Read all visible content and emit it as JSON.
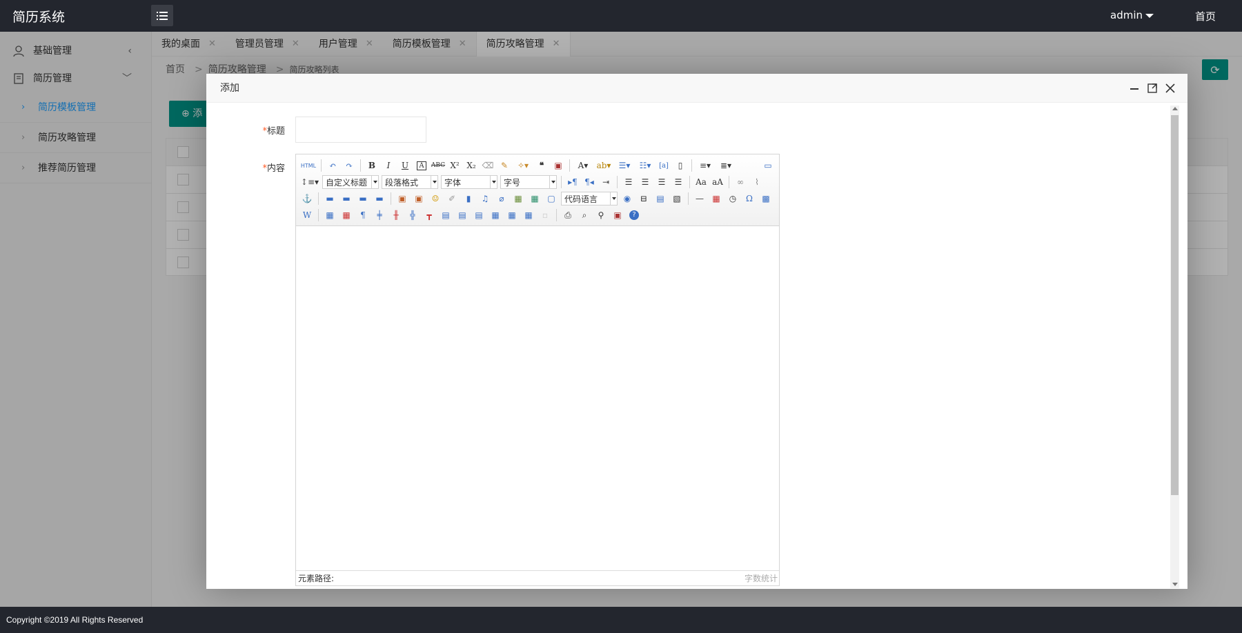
{
  "header": {
    "logo": "简历系统",
    "user": "admin",
    "home": "首页"
  },
  "sidebar": {
    "groups": [
      {
        "label": "基础管理",
        "icon": "user-icon",
        "chevron": "‹"
      },
      {
        "label": "简历管理",
        "icon": "document-icon",
        "chevron": "﹀"
      }
    ],
    "items": [
      {
        "label": "简历模板管理"
      },
      {
        "label": "简历攻略管理"
      },
      {
        "label": "推荐简历管理"
      }
    ]
  },
  "tabs": [
    {
      "label": "我的桌面"
    },
    {
      "label": "管理员管理"
    },
    {
      "label": "用户管理"
    },
    {
      "label": "简历模板管理"
    },
    {
      "label": "简历攻略管理"
    }
  ],
  "breadcrumb": {
    "home": "首页",
    "section": "简历攻略管理",
    "page": "简历攻略列表",
    "sep": ">"
  },
  "content": {
    "add_label": "添加"
  },
  "modal": {
    "title": "添加",
    "form": {
      "title_label": "标题",
      "content_label": "内容",
      "required_mark": "*"
    },
    "editor": {
      "html_label": "HTML",
      "custom_title": "自定义标题",
      "paragraph": "段落格式",
      "font_family": "字体",
      "font_size": "字号",
      "code_lang": "代码语言",
      "element_path": "元素路径:",
      "word_count": "字数统计"
    }
  },
  "footer": {
    "copyright": "Copyright ©2019 All Rights Reserved"
  },
  "colors": {
    "header_bg": "#23262e",
    "accent_green": "#009688",
    "link_blue": "#1e9fff"
  }
}
